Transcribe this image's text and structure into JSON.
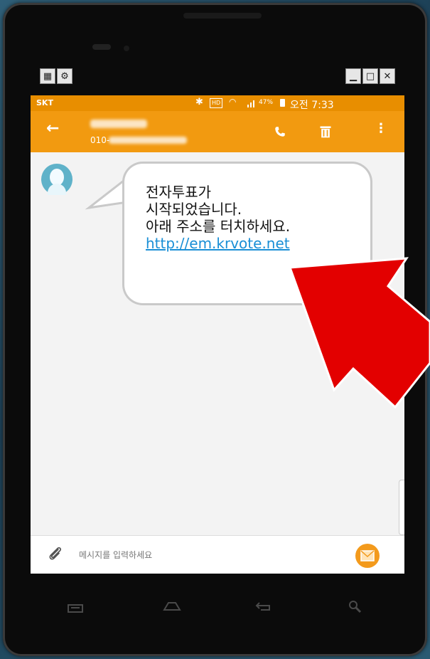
{
  "window_controls": {
    "left_icons": [
      "window-grid-icon",
      "settings-cog-icon"
    ],
    "right_icons": [
      "minimize-icon",
      "maximize-icon",
      "close-icon"
    ]
  },
  "status_bar": {
    "carrier": "SKT",
    "battery": "47%",
    "time": "오전 7:33",
    "icons": [
      "bluetooth-icon",
      "hd-voice-icon",
      "wifi-icon",
      "signal-icon",
      "battery-icon"
    ]
  },
  "app_bar": {
    "contact_number": "010-",
    "icons": [
      "back-arrow-icon",
      "call-icon",
      "delete-icon",
      "more-icon"
    ]
  },
  "message": {
    "lines": [
      "전자투표가",
      "시작되었습니다.",
      "아래 주소를 터치하세요."
    ],
    "link": "http://em.krvote.net"
  },
  "composer": {
    "placeholder": "메시지를 입력하세요",
    "icons": [
      "attach-icon",
      "send-icon"
    ]
  },
  "nav_bar": {
    "icons": [
      "recent-apps-icon",
      "home-icon",
      "back-icon",
      "search-icon"
    ]
  },
  "colors": {
    "accent": "#f29a10",
    "status_bar": "#e88e00",
    "link": "#1a8fd6",
    "arrow": "#e30000"
  }
}
